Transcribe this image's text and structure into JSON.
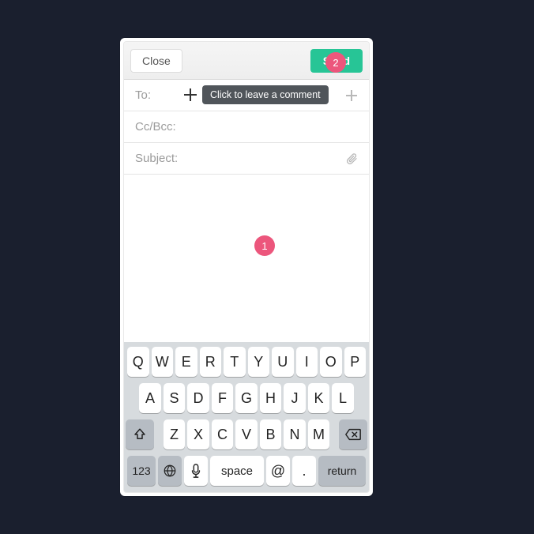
{
  "toolbar": {
    "close_label": "Close",
    "send_label": "Send"
  },
  "annotations": {
    "marker1": "1",
    "marker2": "2",
    "tooltip_text": "Click to leave a comment"
  },
  "fields": {
    "to_label": "To:",
    "ccbcc_label": "Cc/Bcc:",
    "subject_label": "Subject:"
  },
  "keyboard": {
    "row1": [
      "Q",
      "W",
      "E",
      "R",
      "T",
      "Y",
      "U",
      "I",
      "O",
      "P"
    ],
    "row2": [
      "A",
      "S",
      "D",
      "F",
      "G",
      "H",
      "J",
      "K",
      "L"
    ],
    "row3": [
      "Z",
      "X",
      "C",
      "V",
      "B",
      "N",
      "M"
    ],
    "key_123": "123",
    "key_space": "space",
    "key_at": "@",
    "key_dot": ".",
    "key_return": "return"
  }
}
